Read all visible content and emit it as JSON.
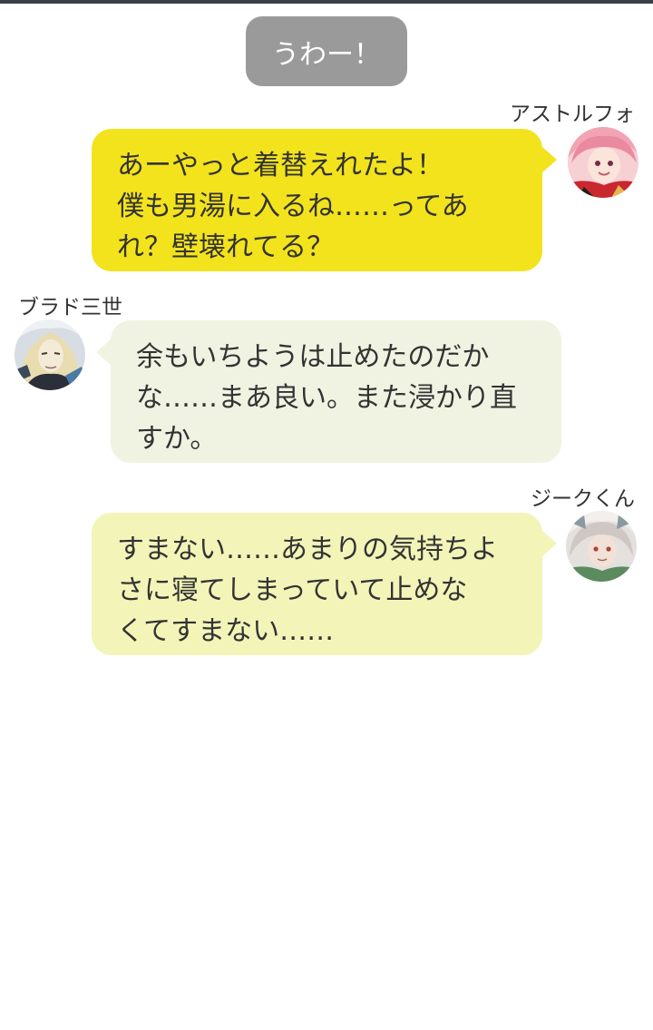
{
  "system_message": "うわー！",
  "messages": [
    {
      "sender": "アストルフォ",
      "avatar": "astolfo-avatar",
      "side": "right",
      "bubble_color": "#f3e31d",
      "lines": [
        "あーやっと着替えれたよ！",
        "僕も男湯に入るね……ってあ",
        "れ？壁壊れてる？"
      ]
    },
    {
      "sender": "ブラド三世",
      "avatar": "vlad-avatar",
      "side": "left",
      "bubble_color": "#f1f3e2",
      "lines": [
        "余もいちようは止めたのだか",
        "な……まあ良い。また浸かり直",
        "すか。"
      ]
    },
    {
      "sender": "ジークくん",
      "avatar": "sieg-avatar",
      "side": "right",
      "bubble_color": "#f3f4b8",
      "lines": [
        "すまない……あまりの気持ちよ",
        "さに寝てしまっていて止めな",
        "くてすまない……"
      ]
    }
  ],
  "colors": {
    "system_bubble": "#9a9a9a",
    "top_bar": "#3a3f4b",
    "background": "#ffffff"
  }
}
